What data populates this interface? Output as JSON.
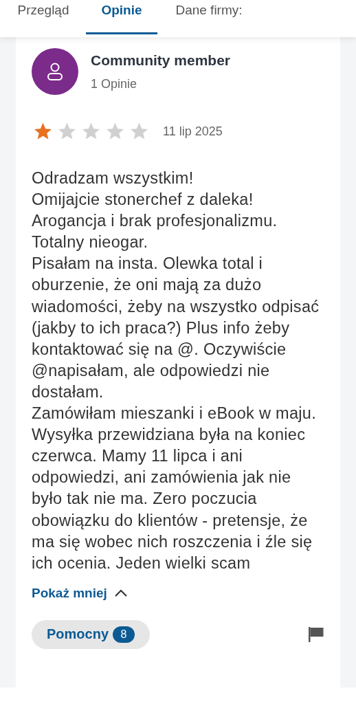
{
  "tabs": [
    {
      "label": "Przegląd",
      "selected": false
    },
    {
      "label": "Opinie",
      "selected": true
    },
    {
      "label": "Dane firmy:",
      "selected": false
    }
  ],
  "review": {
    "author": "Community member",
    "author_reviews": "1 Opinie",
    "stars": 1,
    "date": "11 lip 2025",
    "paragraphs": [
      "Odradzam wszystkim!",
      "Omijajcie stonerchef z daleka!",
      "Arogancja i brak profesjonalizmu.",
      "Totalny nieogar.",
      "Pisałam na insta. Olewka total i oburzenie, że oni mają za dużo wiadomości, żeby na wszystko odpisać (jakby to ich praca?) Plus info żeby kontaktować się na @. Oczywiście @napisałam, ale odpowiedzi nie dostałam.",
      "Zamówiłam mieszanki i eBook w maju. Wysyłka przewidziana była na koniec czerwca. Mamy 11 lipca i ani odpowiedzi, ani zamówienia jak nie było tak nie ma. Zero poczucia obowiązku do klientów - pretensje, że ma się wobec nich roszczenia i źle się ich ocenia. Jeden wielki scam"
    ],
    "expanded": true,
    "toggle_label": "Pokaż mniej",
    "helpful_label": "Pomocny",
    "helpful_count": "8"
  }
}
